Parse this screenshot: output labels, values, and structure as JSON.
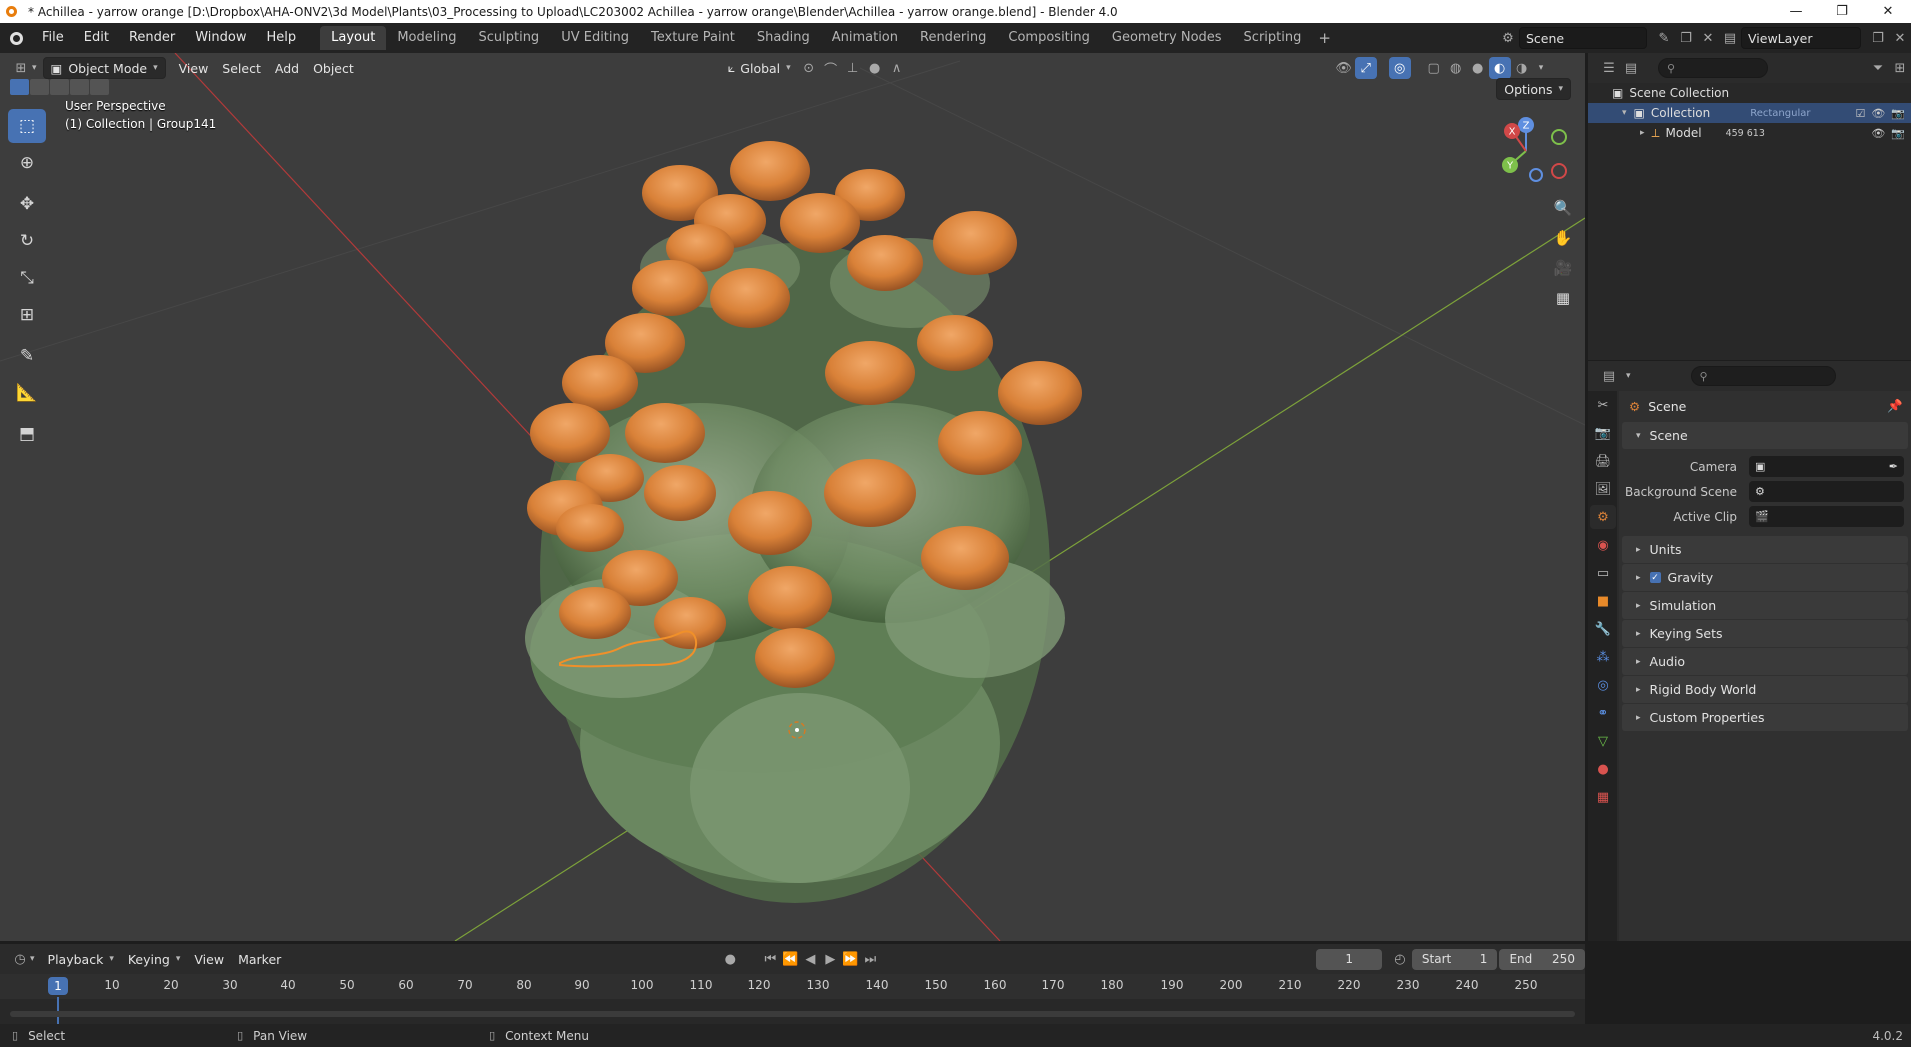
{
  "window": {
    "title": "* Achillea - yarrow orange [D:\\Dropbox\\AHA-ONV2\\3d Model\\Plants\\03_Processing to Upload\\LC203002 Achillea - yarrow orange\\Blender\\Achillea - yarrow orange.blend] - Blender 4.0",
    "controls": [
      "—",
      "❐",
      "✕"
    ]
  },
  "menu": [
    "File",
    "Edit",
    "Render",
    "Window",
    "Help"
  ],
  "workspaces": [
    "Layout",
    "Modeling",
    "Sculpting",
    "UV Editing",
    "Texture Paint",
    "Shading",
    "Animation",
    "Rendering",
    "Compositing",
    "Geometry Nodes",
    "Scripting"
  ],
  "active_workspace": "Layout",
  "add_workspace": "+",
  "scene_field": "Scene",
  "viewlayer_field": "ViewLayer",
  "viewport": {
    "mode": "Object Mode",
    "menus": [
      "View",
      "Select",
      "Add",
      "Object"
    ],
    "orientation": "Global",
    "options_label": "Options",
    "perspective_label": "User Perspective",
    "collection_label": "(1) Collection | Group141",
    "gizmo_axes": [
      "X",
      "Y",
      "Z"
    ]
  },
  "outliner": {
    "root": "Scene Collection",
    "collection": "Collection",
    "collection_badge": "Rectangular",
    "model": "Model",
    "model_count": "459 613"
  },
  "properties": {
    "breadcrumb": "Scene",
    "panel_title": "Scene",
    "fields": [
      {
        "label": "Camera",
        "value": ""
      },
      {
        "label": "Background Scene",
        "value": ""
      },
      {
        "label": "Active Clip",
        "value": ""
      }
    ],
    "collapsed_panels": [
      "Units",
      "Gravity",
      "Simulation",
      "Keying Sets",
      "Audio",
      "Rigid Body World",
      "Custom Properties"
    ],
    "gravity_checked": true
  },
  "timeline": {
    "menus": [
      "Playback",
      "Keying",
      "View",
      "Marker"
    ],
    "current_frame": "1",
    "start_label": "Start",
    "start_value": "1",
    "end_label": "End",
    "end_value": "250",
    "ruler": [
      "10",
      "20",
      "30",
      "40",
      "50",
      "60",
      "70",
      "80",
      "90",
      "100",
      "110",
      "120",
      "130",
      "140",
      "150",
      "160",
      "170",
      "180",
      "190",
      "200",
      "210",
      "220",
      "230",
      "240",
      "250"
    ]
  },
  "statusbar": {
    "items": [
      "Select",
      "Pan View",
      "Context Menu"
    ],
    "version": "4.0.2"
  },
  "colors": {
    "accent": "#4772b3",
    "viewport_bg": "#3d3d3d",
    "flower": "#e08a3c",
    "leaf": "#5f7e55",
    "x_axis": "#c53b3b",
    "y_axis": "#7fb03a",
    "selection_outline": "#f0902a"
  }
}
